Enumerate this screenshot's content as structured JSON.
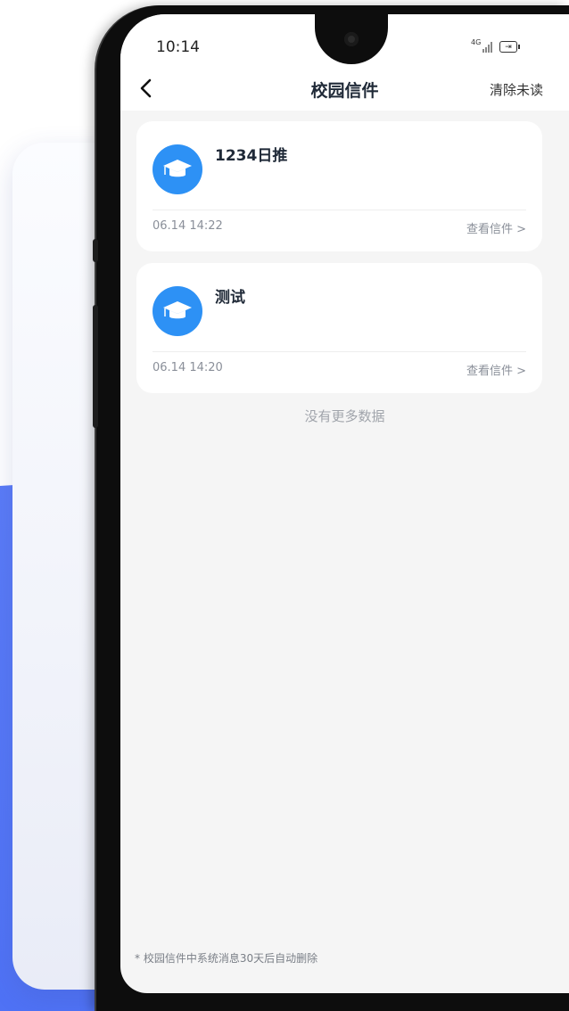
{
  "status_bar": {
    "time": "10:14",
    "network": "4G"
  },
  "header": {
    "title": "校园信件",
    "action": "清除未读"
  },
  "letters": [
    {
      "title": "1234日推",
      "time": "06.14 14:22",
      "link": "查看信件 >"
    },
    {
      "title": "测试",
      "time": "06.14 14:20",
      "link": "查看信件 >"
    }
  ],
  "list_end_text": "没有更多数据",
  "footnote": "* 校园信件中系统消息30天后自动删除",
  "colors": {
    "accent": "#2d91f5",
    "background": "#f5f5f5",
    "card": "#ffffff",
    "blue_backdrop": "#5b7cf7"
  }
}
